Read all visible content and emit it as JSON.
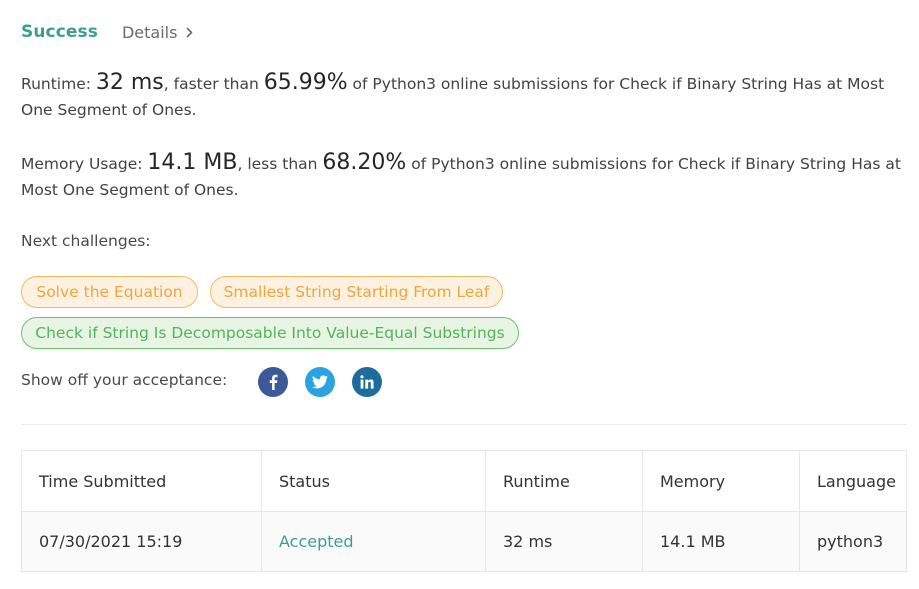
{
  "header": {
    "status": "Success",
    "details_label": "Details"
  },
  "runtime": {
    "label": "Runtime: ",
    "value": "32 ms",
    "comparison": ", faster than ",
    "percent": "65.99%",
    "suffix": " of Python3 online submissions for Check if Binary String Has at Most One Segment of Ones."
  },
  "memory": {
    "label": "Memory Usage: ",
    "value": "14.1 MB",
    "comparison": ", less than ",
    "percent": "68.20%",
    "suffix": " of Python3 online submissions for Check if Binary String Has at Most One Segment of Ones."
  },
  "next": {
    "label": "Next challenges:",
    "challenges": [
      {
        "title": "Solve the Equation",
        "difficulty": "medium"
      },
      {
        "title": "Smallest String Starting From Leaf",
        "difficulty": "medium"
      },
      {
        "title": "Check if String Is Decomposable Into Value-Equal Substrings",
        "difficulty": "easy"
      }
    ]
  },
  "share": {
    "label": "Show off your acceptance:",
    "icons": [
      "facebook-icon",
      "twitter-icon",
      "linkedin-icon"
    ]
  },
  "table": {
    "headers": [
      "Time Submitted",
      "Status",
      "Runtime",
      "Memory",
      "Language"
    ],
    "rows": [
      {
        "time": "07/30/2021 15:19",
        "status": "Accepted",
        "runtime": "32 ms",
        "memory": "14.1 MB",
        "language": "python3"
      }
    ]
  },
  "colors": {
    "success": "#3c9e8c",
    "medium_chip": "#f0a43c",
    "easy_chip": "#52b35a",
    "facebook": "#3b5a97",
    "twitter": "#2ba2e1",
    "linkedin": "#1e6c9c"
  }
}
